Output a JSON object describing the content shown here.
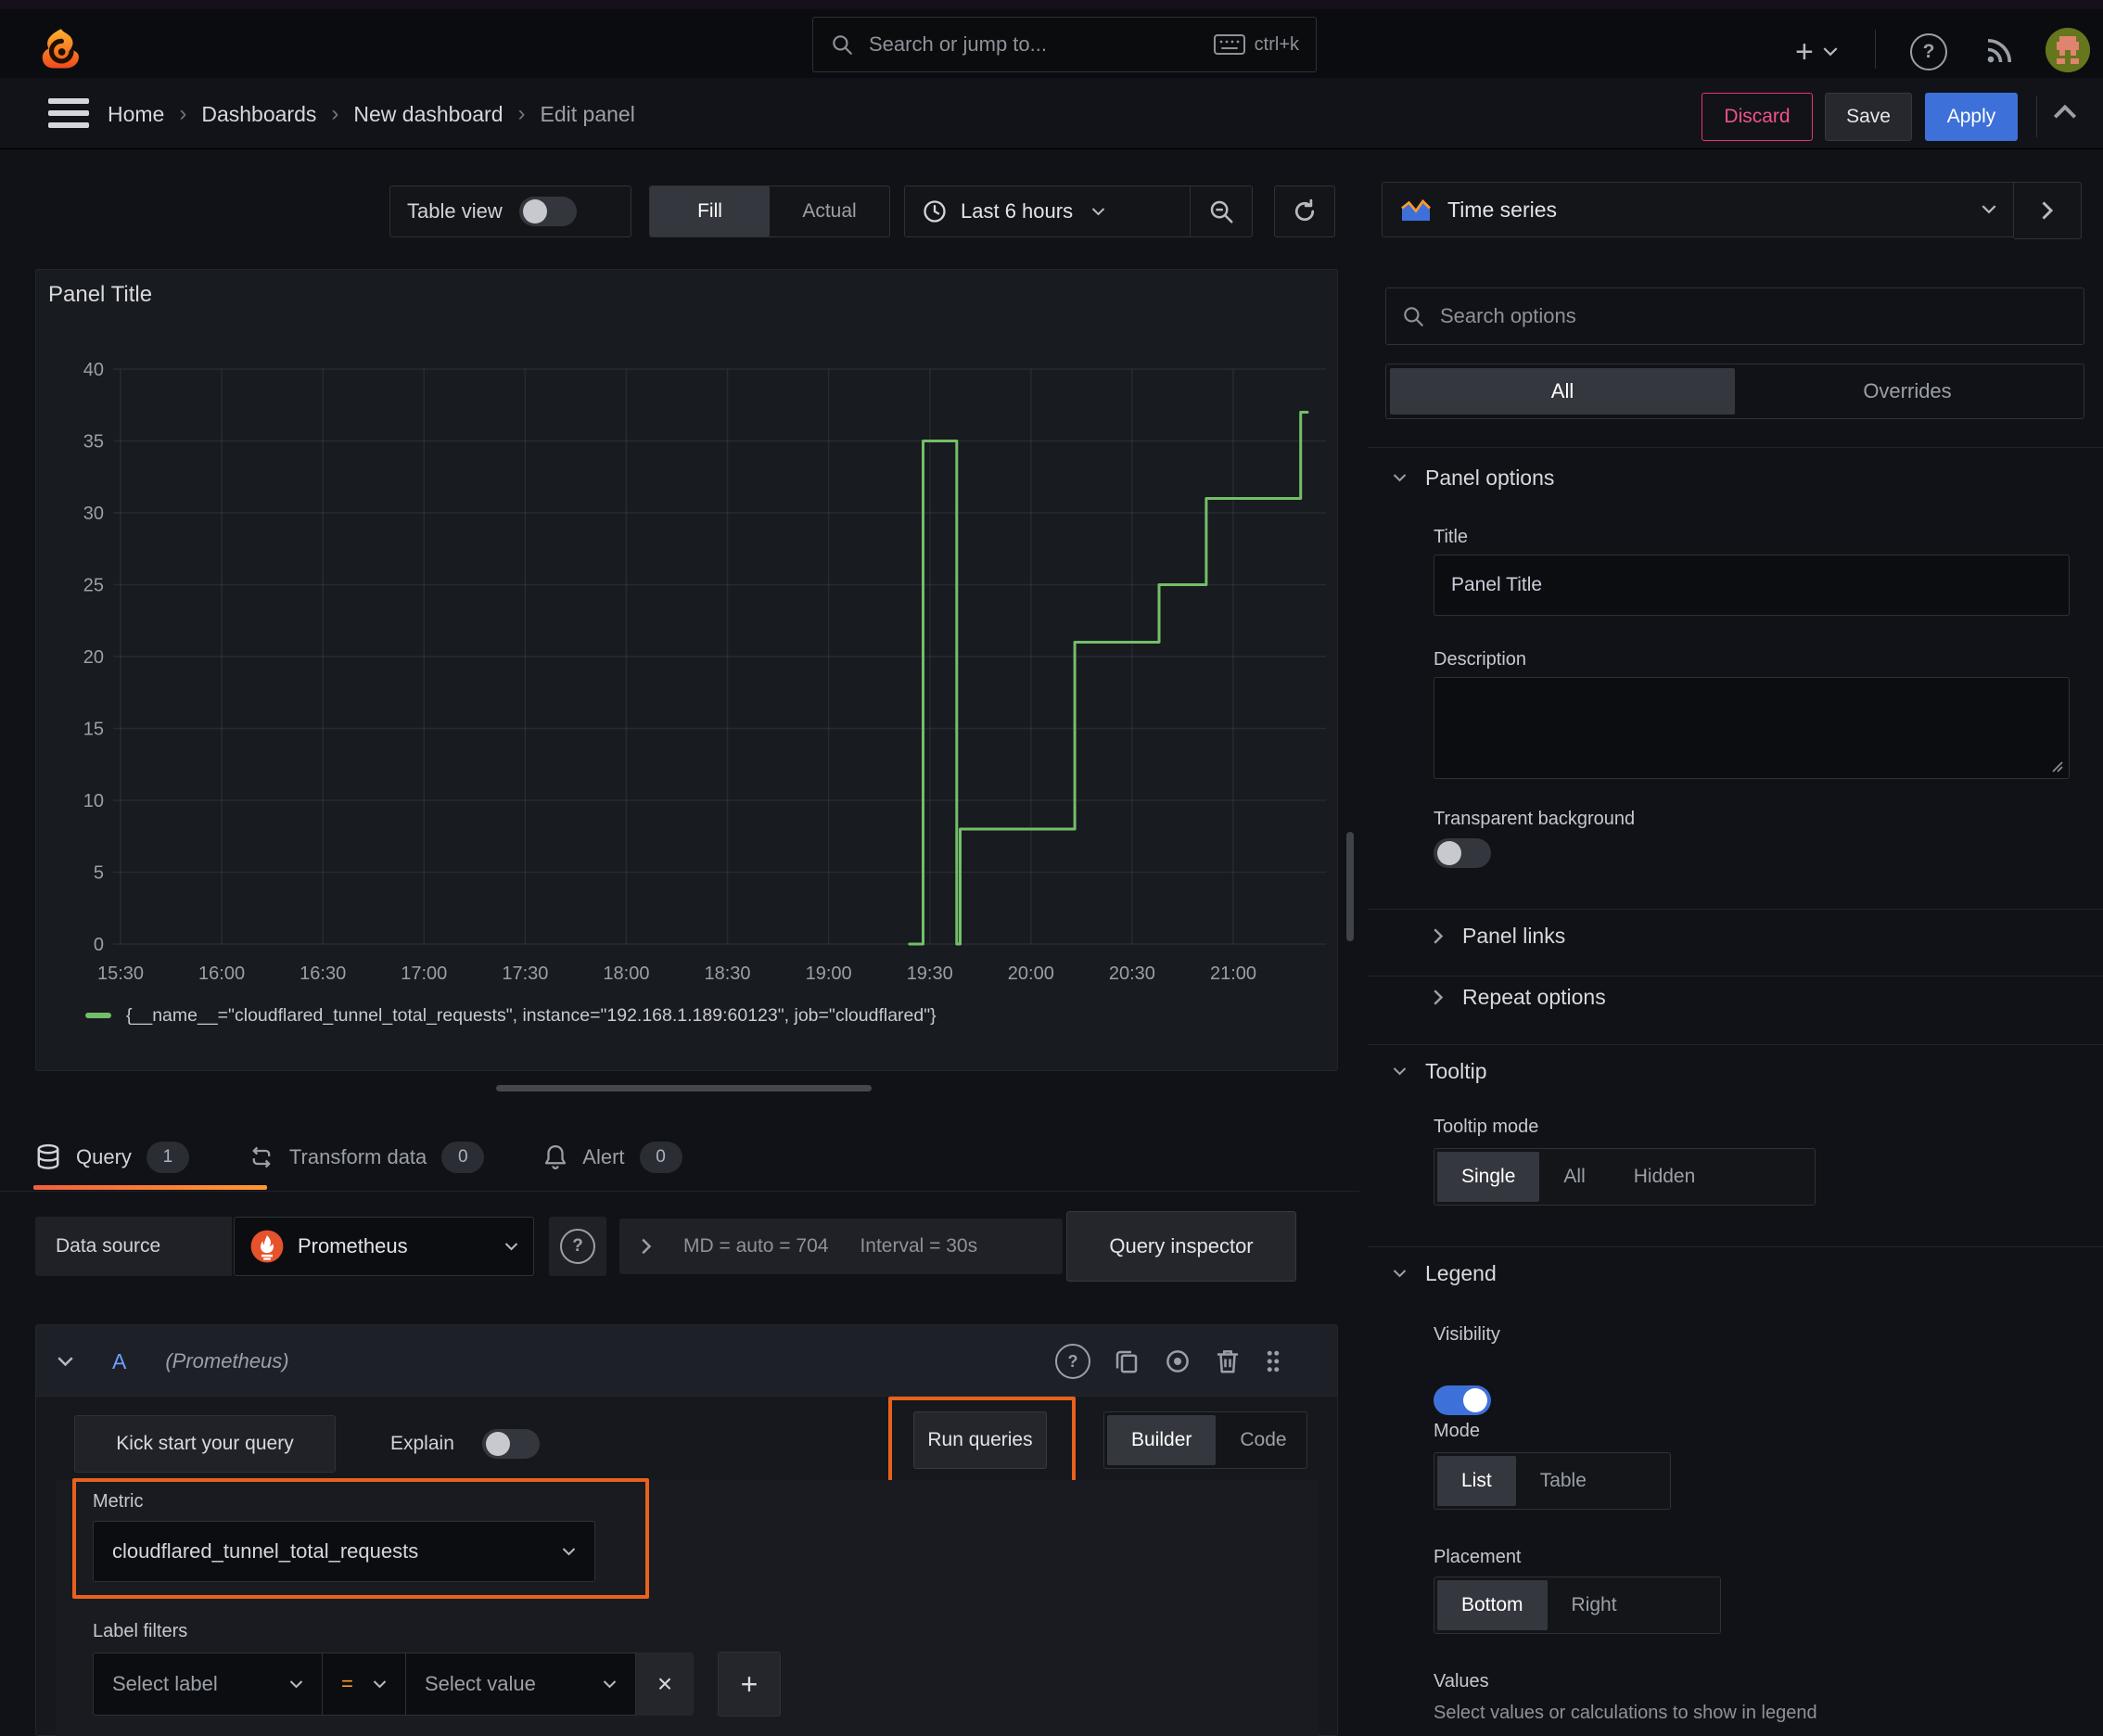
{
  "topnav": {
    "search_placeholder": "Search or jump to...",
    "shortcut": "ctrl+k"
  },
  "breadcrumb": {
    "items": [
      "Home",
      "Dashboards",
      "New dashboard",
      "Edit panel"
    ]
  },
  "actions": {
    "discard": "Discard",
    "save": "Save",
    "apply": "Apply"
  },
  "toolbar": {
    "table_view": "Table view",
    "fill": "Fill",
    "actual": "Actual",
    "time_range": "Last 6 hours"
  },
  "panel": {
    "title": "Panel Title"
  },
  "chart_data": {
    "type": "line",
    "title": "Panel Title",
    "xlabel": "",
    "ylabel": "",
    "ylim": [
      0,
      40
    ],
    "grid": true,
    "legend_position": "bottom",
    "x_ticks": [
      "15:30",
      "16:00",
      "16:30",
      "17:00",
      "17:30",
      "18:00",
      "18:30",
      "19:00",
      "19:30",
      "20:00",
      "20:30",
      "21:00"
    ],
    "y_ticks": [
      0,
      5,
      10,
      15,
      20,
      25,
      30,
      35,
      40
    ],
    "x_minutes_domain": [
      0,
      352
    ],
    "series": [
      {
        "name": "{__name__=\"cloudflared_tunnel_total_requests\", instance=\"192.168.1.189:60123\", job=\"cloudflared\"}",
        "color": "#73bf69",
        "points_min_value": [
          [
            234,
            0
          ],
          [
            238,
            0
          ],
          [
            238,
            35
          ],
          [
            248,
            35
          ],
          [
            248,
            0
          ],
          [
            249,
            0
          ],
          [
            249,
            8
          ],
          [
            283,
            8
          ],
          [
            283,
            21
          ],
          [
            308,
            21
          ],
          [
            308,
            25
          ],
          [
            322,
            25
          ],
          [
            322,
            31
          ],
          [
            350,
            31
          ],
          [
            350,
            37
          ],
          [
            352,
            37
          ]
        ]
      }
    ]
  },
  "tabs": {
    "query": "Query",
    "query_count": "1",
    "transform": "Transform data",
    "transform_count": "0",
    "alert": "Alert",
    "alert_count": "0"
  },
  "datasource_row": {
    "label": "Data source",
    "value": "Prometheus",
    "summary_md": "MD = auto = 704",
    "summary_interval": "Interval = 30s",
    "query_inspector": "Query inspector"
  },
  "query_editor": {
    "ref_id": "A",
    "ds_name": "(Prometheus)",
    "kick_start": "Kick start your query",
    "explain": "Explain",
    "run_queries": "Run queries",
    "builder": "Builder",
    "code": "Code",
    "metric_label": "Metric",
    "metric_value": "cloudflared_tunnel_total_requests",
    "label_filters_label": "Label filters",
    "select_label": "Select label",
    "operator": "=",
    "select_value": "Select value"
  },
  "sidebar": {
    "viz_name": "Time series",
    "search_placeholder": "Search options",
    "tab_all": "All",
    "tab_overrides": "Overrides",
    "panel_options": {
      "header": "Panel options",
      "title_label": "Title",
      "title_value": "Panel Title",
      "description_label": "Description",
      "transparent_label": "Transparent background",
      "links": "Panel links",
      "repeat": "Repeat options"
    },
    "tooltip": {
      "header": "Tooltip",
      "mode_label": "Tooltip mode",
      "options": [
        "Single",
        "All",
        "Hidden"
      ],
      "selected": "Single"
    },
    "legend": {
      "header": "Legend",
      "visibility_label": "Visibility",
      "mode_label": "Mode",
      "mode_options": [
        "List",
        "Table"
      ],
      "mode_selected": "List",
      "placement_label": "Placement",
      "placement_options": [
        "Bottom",
        "Right"
      ],
      "placement_selected": "Bottom",
      "values_label": "Values",
      "values_hint": "Select values or calculations to show in legend"
    }
  },
  "colors": {
    "series_green": "#73bf69",
    "annotation_orange": "#e8611d",
    "tab_accent_orange": "#ff780a",
    "apply_blue": "#3d71d9",
    "discard_pink": "#e5346f",
    "operator_orange": "#ff9830"
  }
}
